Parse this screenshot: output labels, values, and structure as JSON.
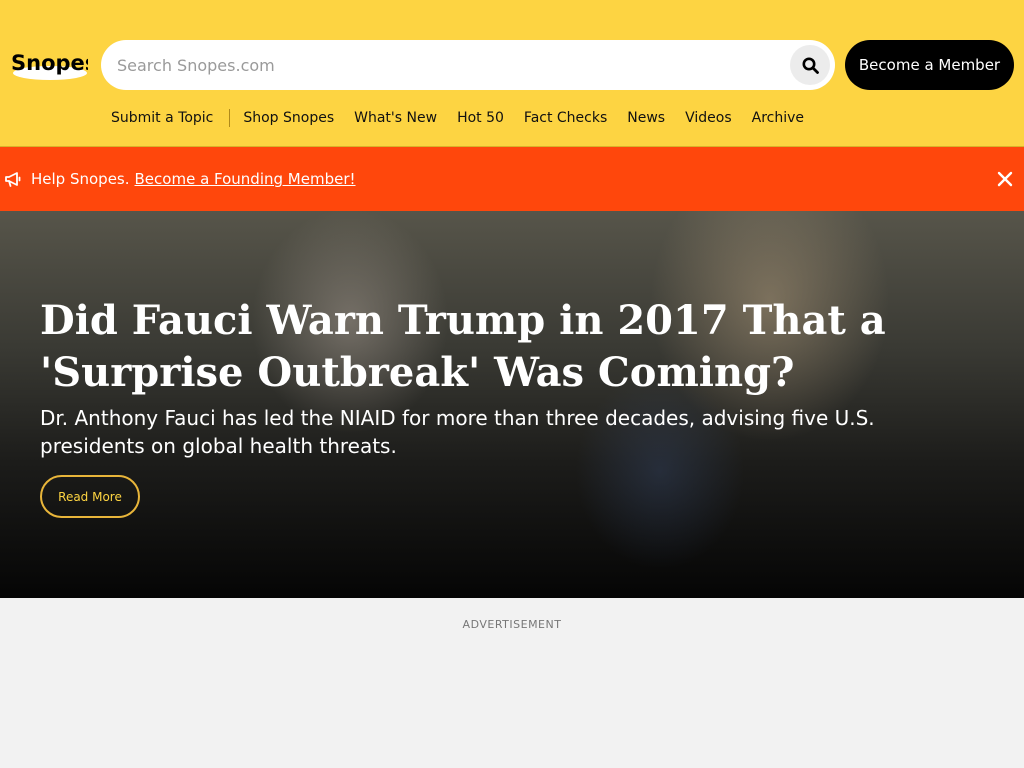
{
  "header": {
    "logo_text": "Snopes",
    "search": {
      "placeholder": "Search Snopes.com",
      "value": ""
    },
    "member_button": "Become a Member",
    "nav": {
      "submit": "Submit a Topic",
      "items": [
        "Shop Snopes",
        "What's New",
        "Hot 50",
        "Fact Checks",
        "News",
        "Videos",
        "Archive"
      ]
    }
  },
  "banner": {
    "text": "Help Snopes.",
    "link": "Become a Founding Member!"
  },
  "hero": {
    "title": "Did Fauci Warn Trump in 2017 That a 'Surprise Outbreak' Was Coming?",
    "description": "Dr. Anthony Fauci has led the NIAID for more than three decades, advising five U.S. presidents on global health threats.",
    "read_more": "Read More"
  },
  "ad": {
    "label": "ADVERTISEMENT"
  },
  "colors": {
    "header_bg": "#fdd442",
    "banner_bg": "#ff470c",
    "button_bg": "#000000",
    "accent": "#fdd442"
  },
  "icons": {
    "search": "search-icon",
    "megaphone": "megaphone-icon",
    "close": "close-icon"
  }
}
